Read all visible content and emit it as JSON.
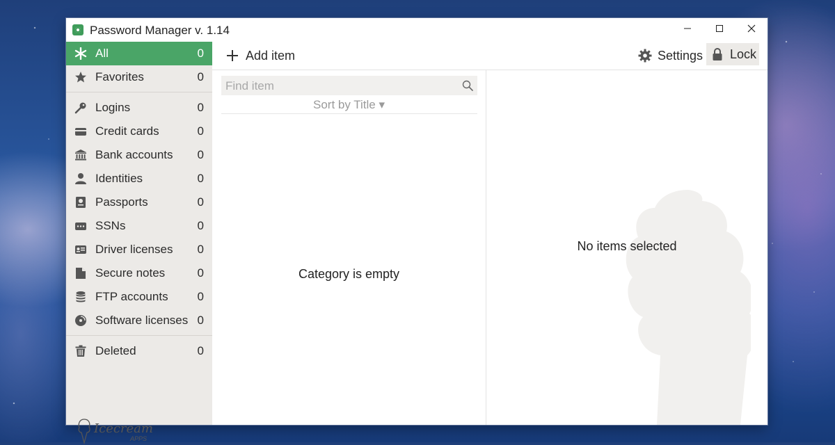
{
  "window": {
    "title": "Password Manager v. 1.14",
    "controls": {
      "minimize": "—",
      "maximize": "☐",
      "close": "✕"
    }
  },
  "sidebar": {
    "items": [
      {
        "label": "All",
        "count": "0",
        "icon": "asterisk-icon",
        "active": true
      },
      {
        "label": "Favorites",
        "count": "0",
        "icon": "star-icon"
      },
      {
        "label": "Logins",
        "count": "0",
        "icon": "key-icon"
      },
      {
        "label": "Credit cards",
        "count": "0",
        "icon": "credit-card-icon"
      },
      {
        "label": "Bank accounts",
        "count": "0",
        "icon": "bank-icon"
      },
      {
        "label": "Identities",
        "count": "0",
        "icon": "person-icon"
      },
      {
        "label": "Passports",
        "count": "0",
        "icon": "passport-icon"
      },
      {
        "label": "SSNs",
        "count": "0",
        "icon": "ssn-card-icon"
      },
      {
        "label": "Driver licenses",
        "count": "0",
        "icon": "id-card-icon"
      },
      {
        "label": "Secure notes",
        "count": "0",
        "icon": "note-icon"
      },
      {
        "label": "FTP accounts",
        "count": "0",
        "icon": "database-icon"
      },
      {
        "label": "Software licenses",
        "count": "0",
        "icon": "disc-icon"
      },
      {
        "label": "Deleted",
        "count": "0",
        "icon": "trash-icon"
      }
    ],
    "brand": {
      "name": "Icecream",
      "sub": "APPS"
    }
  },
  "toolbar": {
    "add_label": "Add item",
    "settings_label": "Settings",
    "lock_label": "Lock"
  },
  "list": {
    "search_placeholder": "Find item",
    "sort_label": "Sort by Title ▾",
    "empty_text": "Category is empty"
  },
  "detail": {
    "empty_text": "No items selected"
  },
  "colors": {
    "accent": "#4aa567",
    "sidebar_bg": "#eceae7"
  }
}
